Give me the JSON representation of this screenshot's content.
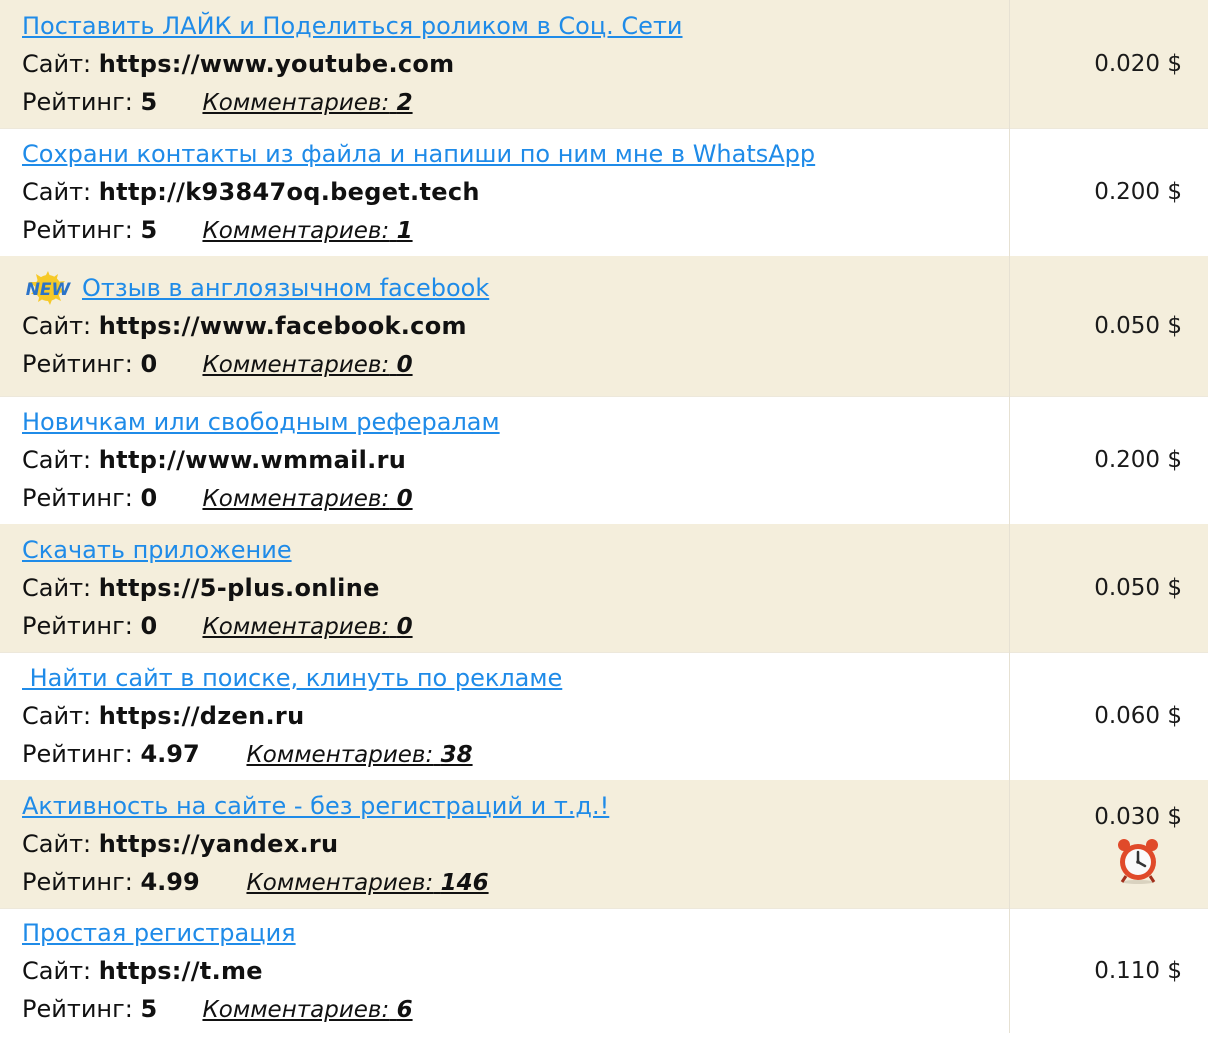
{
  "labels": {
    "site": "Сайт:",
    "rating": "Рейтинг:",
    "comments": "Комментариев:"
  },
  "badge_text": "NEW",
  "tasks": [
    {
      "title": "Поставить ЛАЙК и Поделиться роликом в Соц. Сети",
      "site": "https://www.youtube.com",
      "rating": "5",
      "comments": "2",
      "price": "0.020 $"
    },
    {
      "title": "Сохрани контакты из файла и напиши по ним мне в WhatsApp",
      "site": "http://k93847oq.beget.tech",
      "rating": "5",
      "comments": "1",
      "price": "0.200 $"
    },
    {
      "title": "Отзыв в англоязычном facebook",
      "site": "https://www.facebook.com",
      "rating": "0",
      "comments": "0",
      "price": "0.050 $",
      "is_new": true
    },
    {
      "title": "Новичкам или свободным рефералам",
      "site": "http://www.wmmail.ru",
      "rating": "0",
      "comments": "0",
      "price": "0.200 $"
    },
    {
      "title": "Скачать приложение",
      "site": "https://5-plus.online",
      "rating": "0",
      "comments": "0",
      "price": "0.050 $"
    },
    {
      "title": " Найти сайт в поиске, клинуть по рекламе",
      "site": "https://dzen.ru",
      "rating": "4.97",
      "comments": "38",
      "price": "0.060 $"
    },
    {
      "title": "Активность на сайте - без регистраций и т.д.!",
      "site": "https://yandex.ru",
      "rating": "4.99",
      "comments": "146",
      "price": "0.030 $",
      "timer_icon": "alarm-clock-icon"
    },
    {
      "title": "Простая регистрация",
      "site": "https://t.me",
      "rating": "5",
      "comments": "6",
      "price": "0.110 $"
    }
  ],
  "colors": {
    "link": "#1f8be8",
    "row_alt_bg": "#f4eedc",
    "row_bg": "#ffffff"
  }
}
